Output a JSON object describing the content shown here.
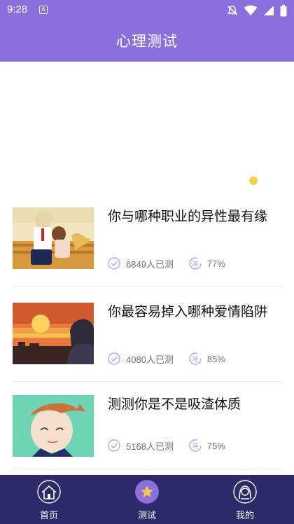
{
  "status_bar": {
    "time": "9:28",
    "notification_icon": "a-icon"
  },
  "header": {
    "title": "心理测试"
  },
  "banner": {
    "indicator_color": "#f5cf4a"
  },
  "tests": [
    {
      "title": "你与哪种职业的异性最有缘",
      "testers": "6849人已测",
      "accuracy": "77%"
    },
    {
      "title": "你最容易掉入哪种爱情陷阱",
      "testers": "4080人已测",
      "accuracy": "85%"
    },
    {
      "title": "测测你是不是吸渣体质",
      "testers": "5168人已测",
      "accuracy": "75%"
    }
  ],
  "accuracy_icon_label": "准",
  "tabs": [
    {
      "label": "首页",
      "icon": "house-icon",
      "active": false
    },
    {
      "label": "测试",
      "icon": "star-icon",
      "active": true
    },
    {
      "label": "我的",
      "icon": "user-icon",
      "active": false
    }
  ],
  "colors": {
    "header": "#8b6fdc",
    "tabbar": "#2c2a6b",
    "meta_icon": "#b9a6ea",
    "active_tab": "#8b6fdc",
    "active_star": "#f4c84a"
  }
}
